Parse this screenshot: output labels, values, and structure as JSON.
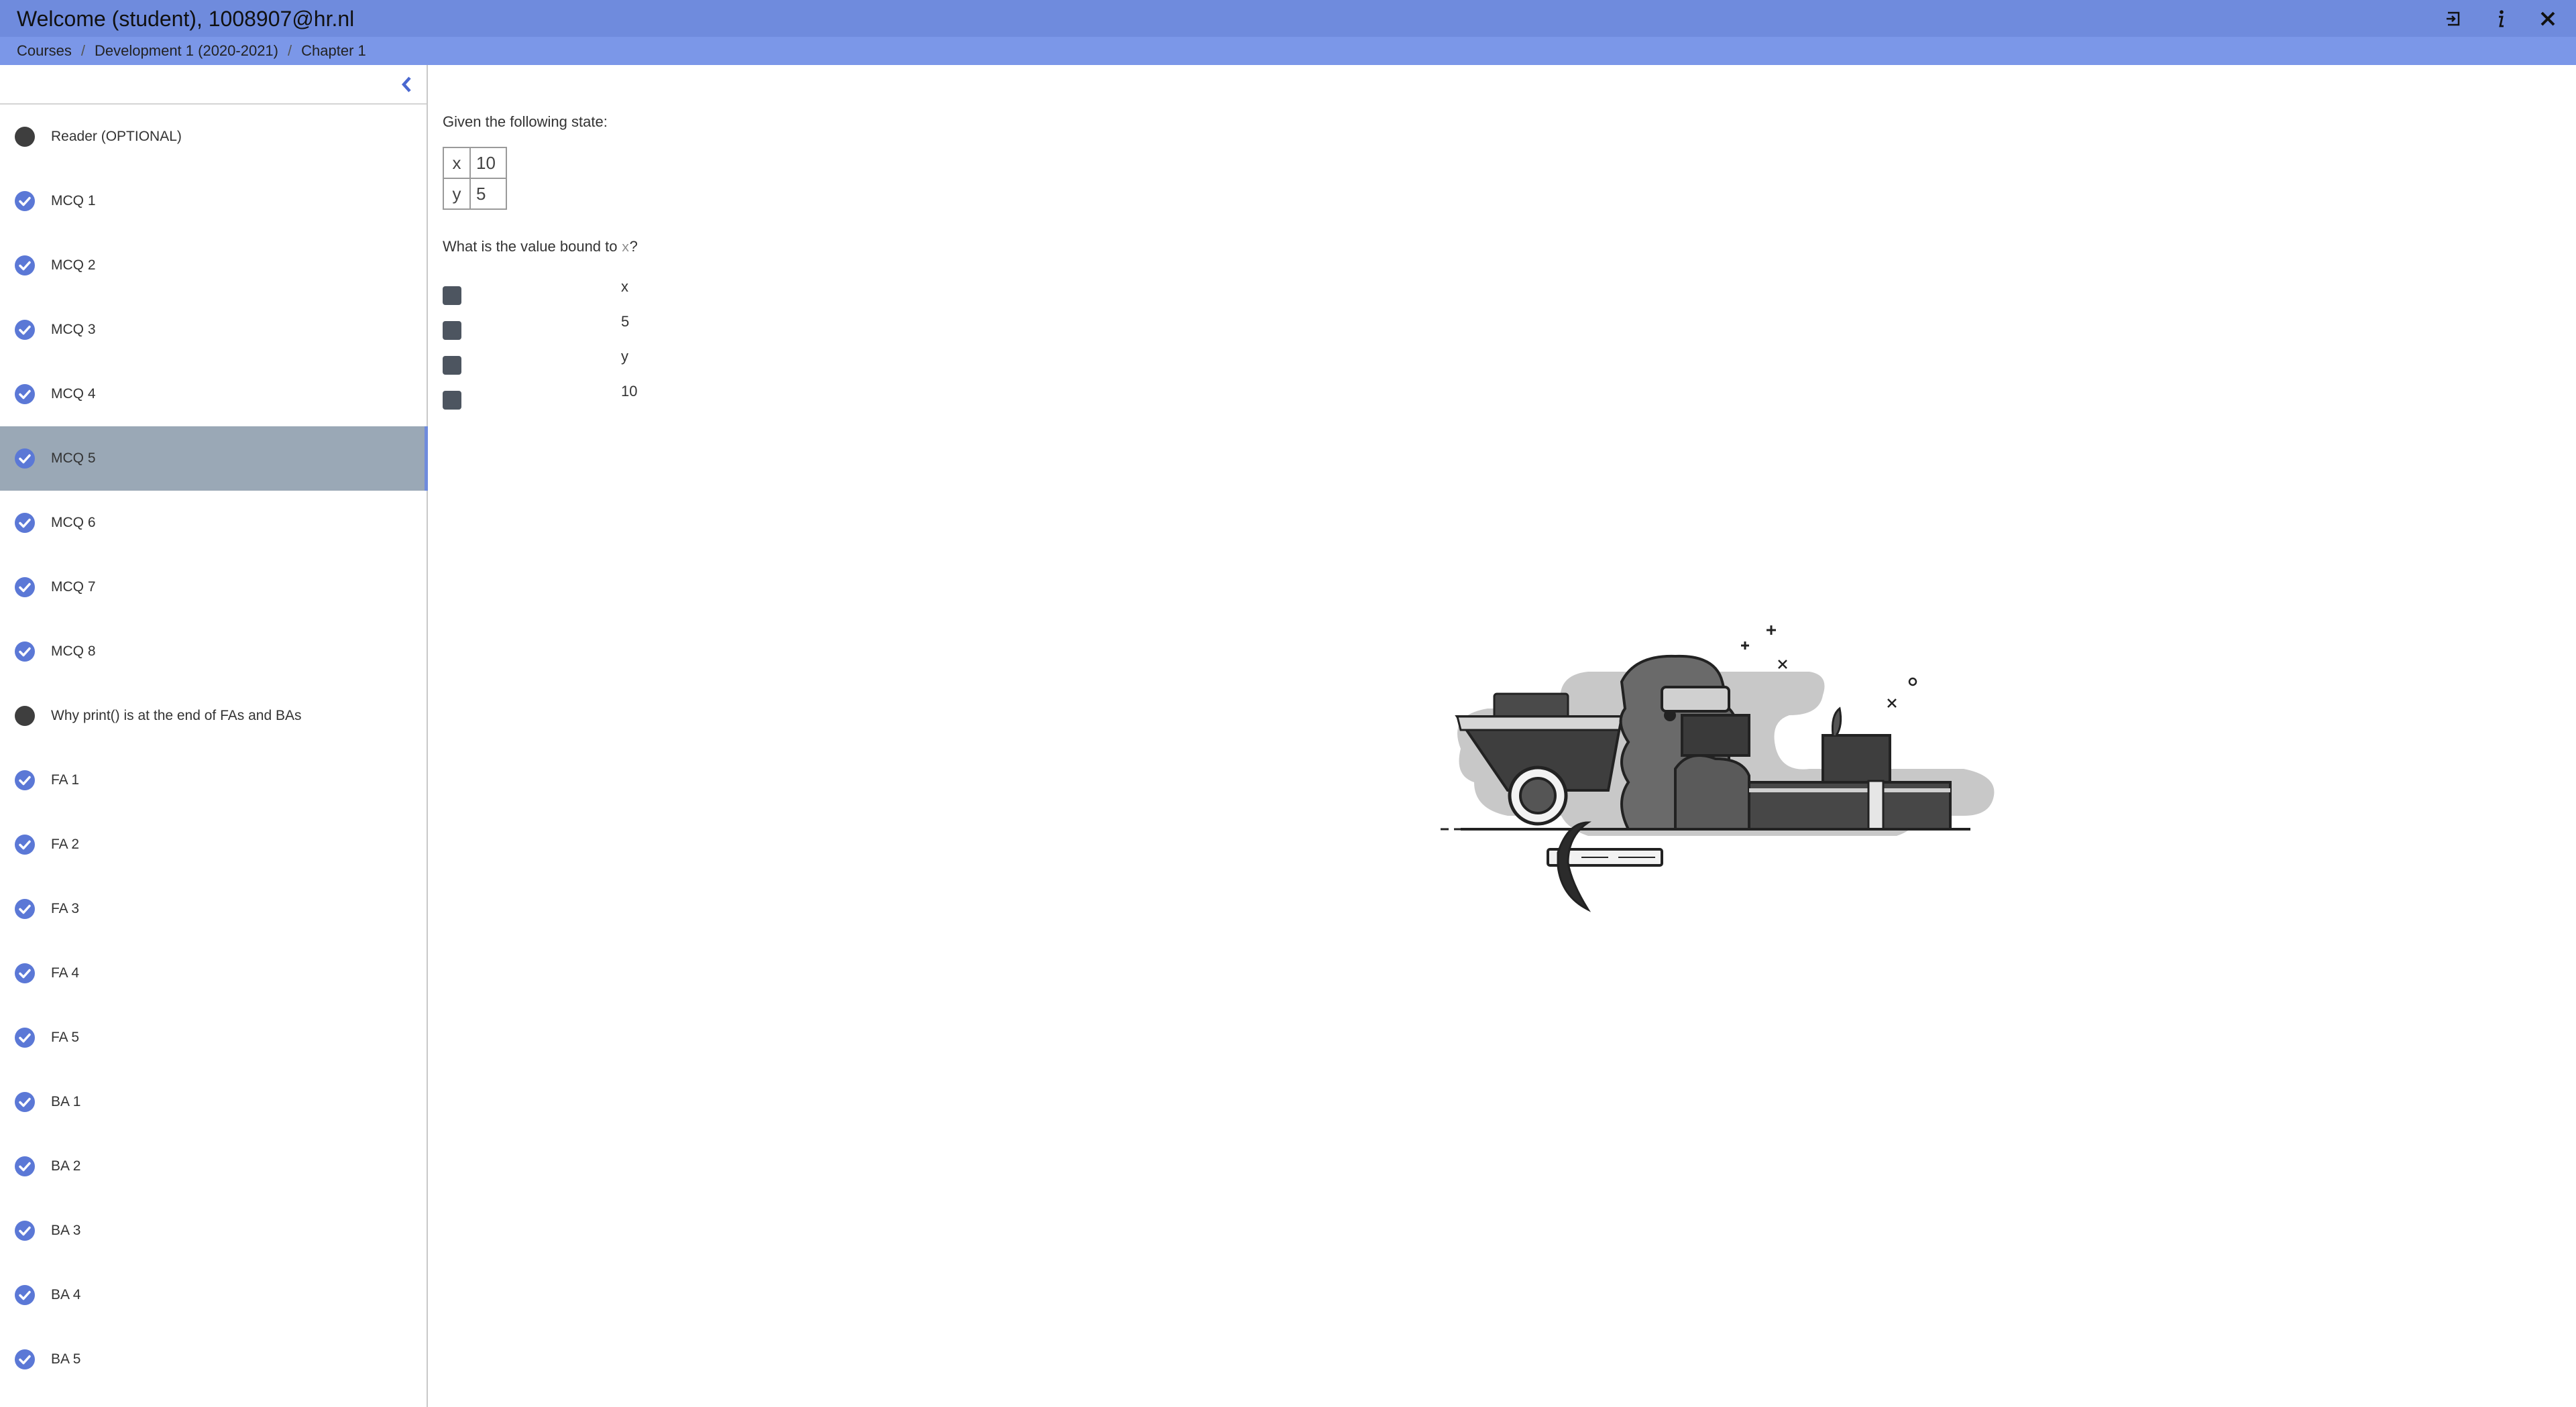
{
  "header": {
    "title": "Welcome (student), 1008907@hr.nl",
    "icons": [
      "exit-icon",
      "info-icon",
      "close-icon"
    ]
  },
  "breadcrumb": {
    "items": [
      "Courses",
      "Development 1 (2020-2021)",
      "Chapter 1"
    ],
    "separator": "/"
  },
  "sidebar": {
    "items": [
      {
        "label": "Reader (OPTIONAL)",
        "status": "incomplete"
      },
      {
        "label": "MCQ 1",
        "status": "done"
      },
      {
        "label": "MCQ 2",
        "status": "done"
      },
      {
        "label": "MCQ 3",
        "status": "done"
      },
      {
        "label": "MCQ 4",
        "status": "done"
      },
      {
        "label": "MCQ 5",
        "status": "done",
        "active": true
      },
      {
        "label": "MCQ 6",
        "status": "done"
      },
      {
        "label": "MCQ 7",
        "status": "done"
      },
      {
        "label": "MCQ 8",
        "status": "done"
      },
      {
        "label": "Why print() is at the end of FAs and BAs",
        "status": "incomplete"
      },
      {
        "label": "FA 1",
        "status": "done"
      },
      {
        "label": "FA 2",
        "status": "done"
      },
      {
        "label": "FA 3",
        "status": "done"
      },
      {
        "label": "FA 4",
        "status": "done"
      },
      {
        "label": "FA 5",
        "status": "done"
      },
      {
        "label": "BA 1",
        "status": "done"
      },
      {
        "label": "BA 2",
        "status": "done"
      },
      {
        "label": "BA 3",
        "status": "done"
      },
      {
        "label": "BA 4",
        "status": "done"
      },
      {
        "label": "BA 5",
        "status": "done"
      }
    ]
  },
  "question": {
    "prompt": "Given the following state:",
    "state": [
      {
        "name": "x",
        "value": "10"
      },
      {
        "name": "y",
        "value": "5"
      }
    ],
    "text_before": "What is the value bound to ",
    "code": "x",
    "text_after": "?",
    "answers": [
      "x",
      "5",
      "y",
      "10"
    ]
  },
  "colors": {
    "header": "#6f8bdd",
    "subheader": "#7b97e8",
    "accent": "#5b78d6",
    "active_item": "#9aa8b6"
  }
}
